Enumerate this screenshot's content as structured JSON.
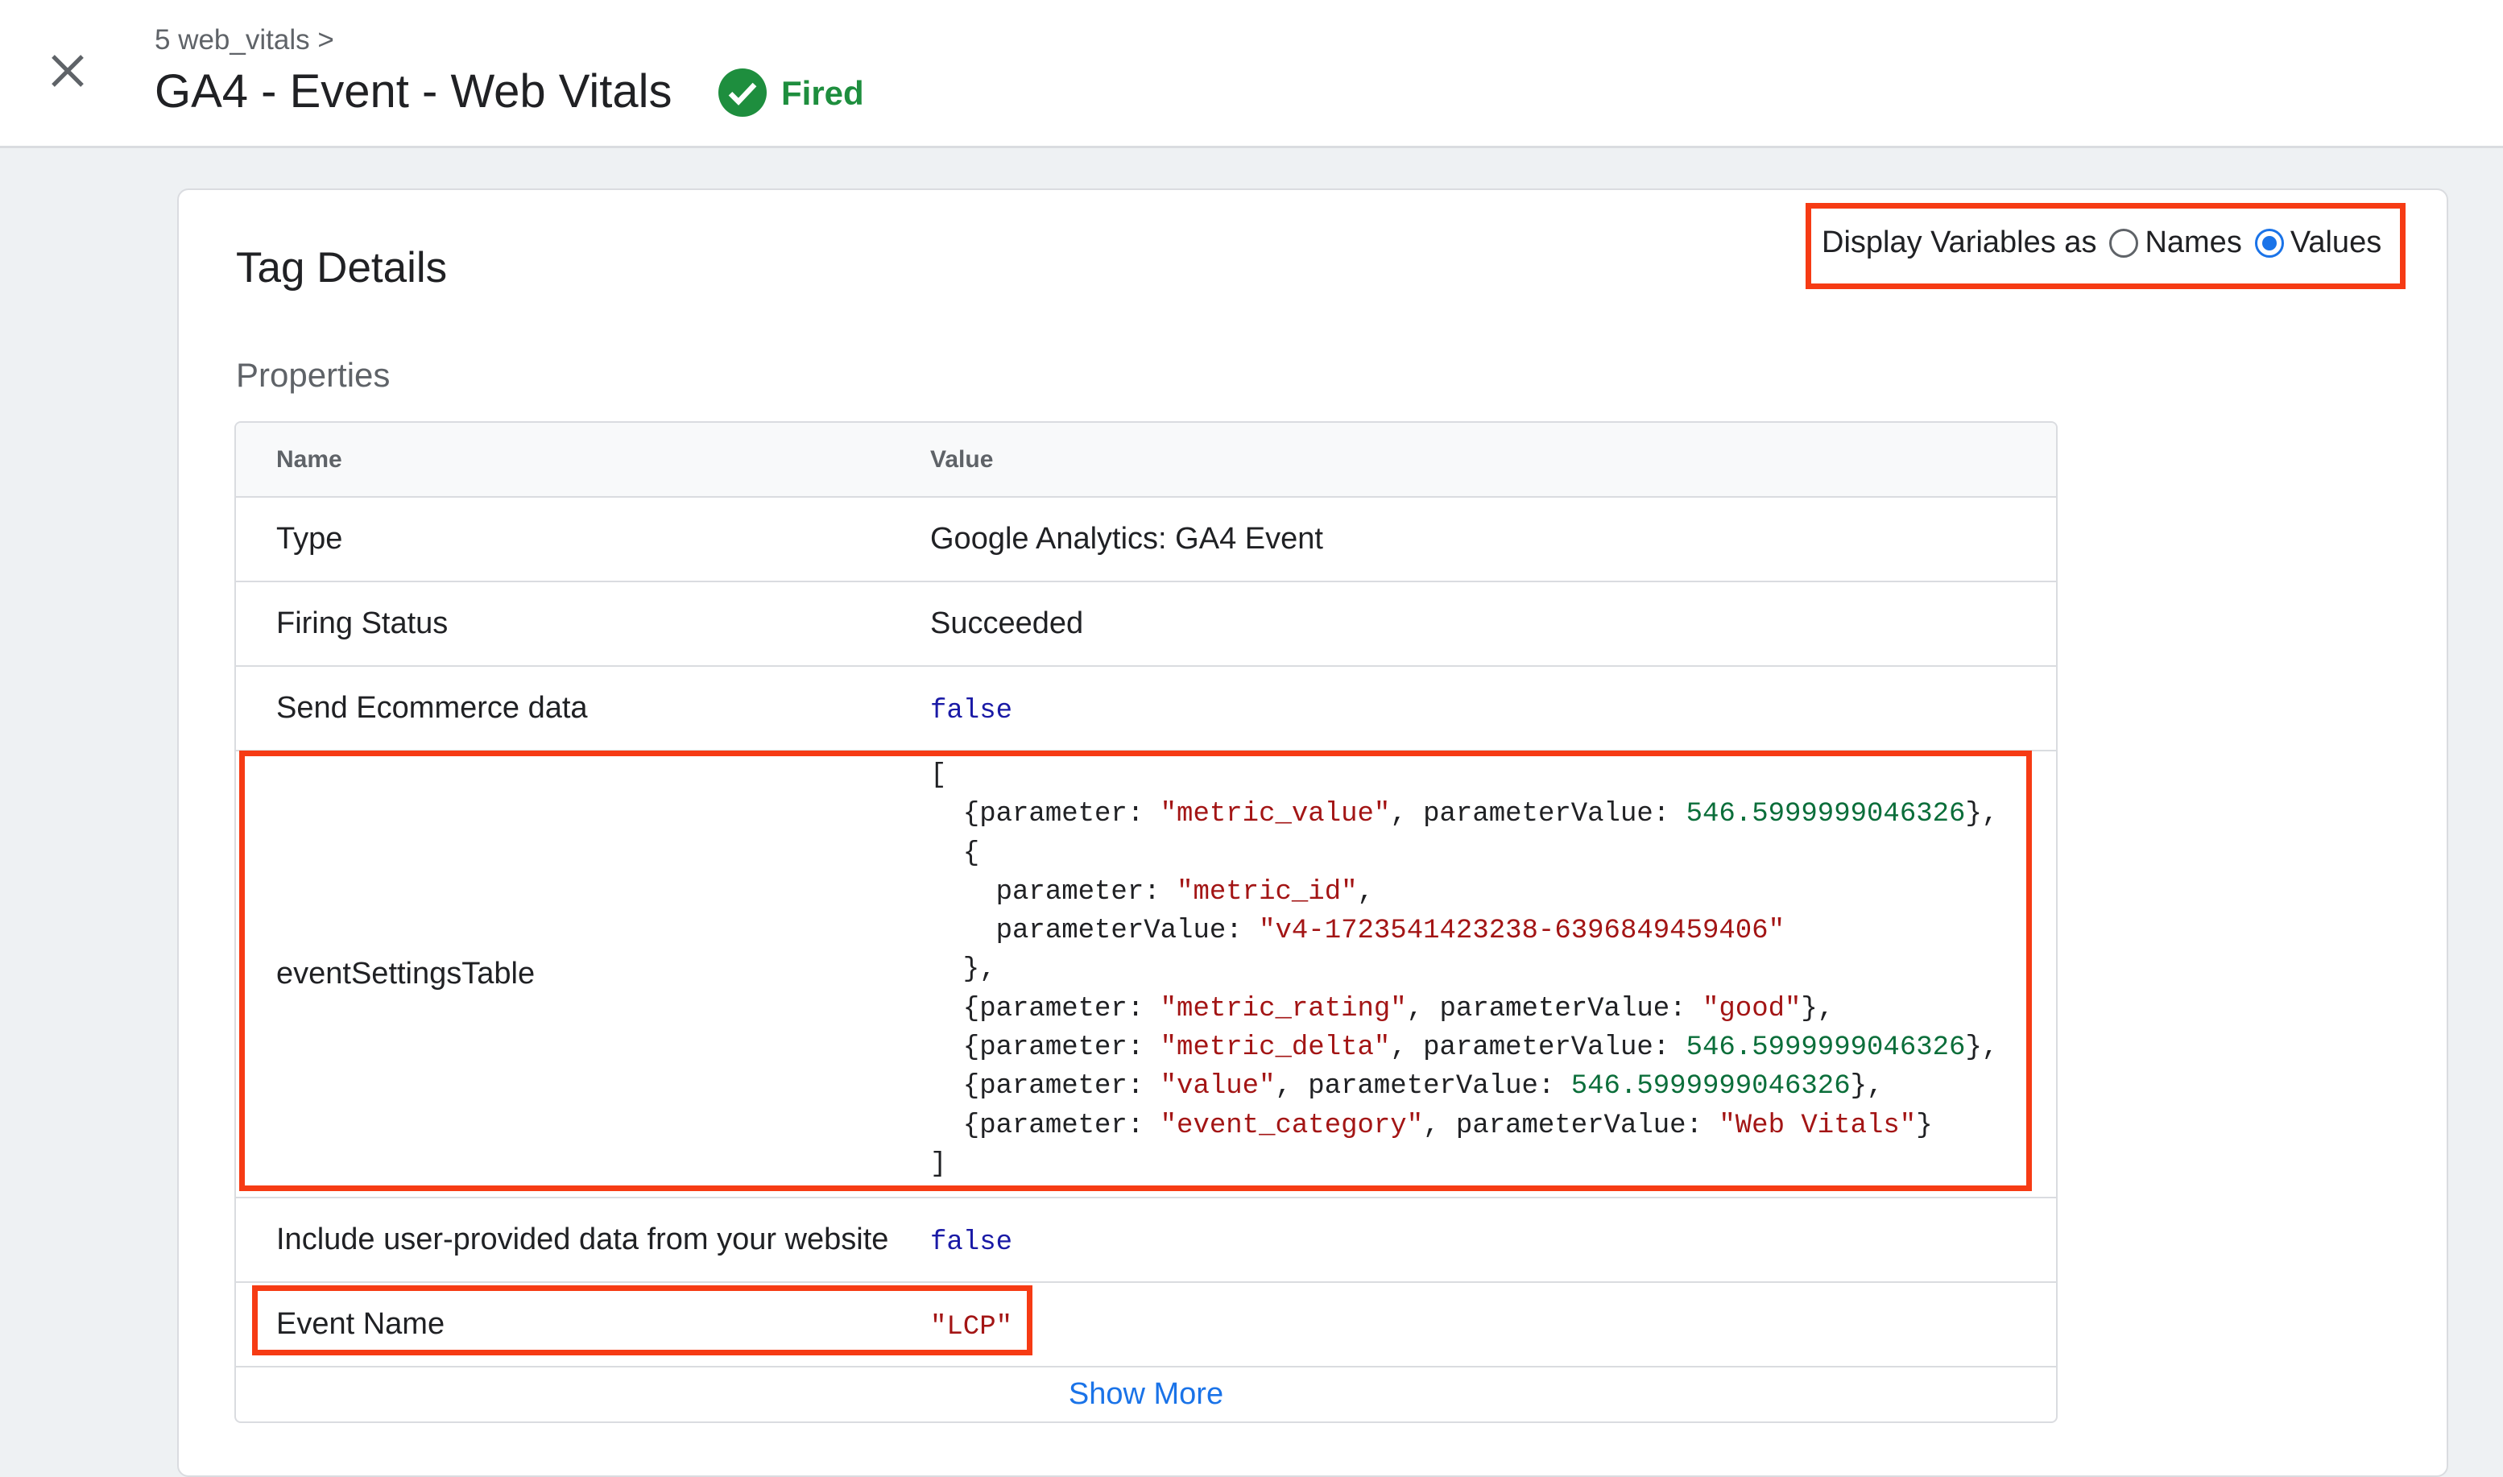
{
  "header": {
    "breadcrumb": "5 web_vitals >",
    "title": "GA4 - Event - Web Vitals",
    "status": "Fired",
    "status_color": "#1e8e3e"
  },
  "card": {
    "title": "Tag Details",
    "display_label": "Display Variables as",
    "opt_names": "Names",
    "opt_values": "Values",
    "selected": "Values",
    "section": "Properties"
  },
  "table": {
    "col_name": "Name",
    "col_value": "Value",
    "rows": [
      {
        "name": "Type",
        "value": "Google Analytics: GA4 Event"
      },
      {
        "name": "Firing Status",
        "value": "Succeeded"
      },
      {
        "name": "Send Ecommerce data",
        "value": "false"
      },
      {
        "name": "eventSettingsTable"
      },
      {
        "name": "Include user-provided data from your website",
        "value": "false"
      },
      {
        "name": "Event Name",
        "value": "\"LCP\""
      }
    ],
    "show_more": "Show More"
  },
  "code": {
    "open": "[",
    "close": "]",
    "l1": [
      "  {parameter: ",
      "\"metric_value\"",
      ", parameterValue: ",
      "546.5999999046326",
      "},"
    ],
    "l2": "  {",
    "l3": [
      "    parameter: ",
      "\"metric_id\"",
      ","
    ],
    "l4": [
      "    parameterValue: ",
      "\"v4-1723541423238-6396849459406\""
    ],
    "l5": "  },",
    "l6": [
      "  {parameter: ",
      "\"metric_rating\"",
      ", parameterValue: ",
      "\"good\"",
      "},"
    ],
    "l7": [
      "  {parameter: ",
      "\"metric_delta\"",
      ", parameterValue: ",
      "546.5999999046326",
      "},"
    ],
    "l8": [
      "  {parameter: ",
      "\"value\"",
      ", parameterValue: ",
      "546.5999999046326",
      "},"
    ],
    "l9": [
      "  {parameter: ",
      "\"event_category\"",
      ", parameterValue: ",
      "\"Web Vitals\"",
      "}"
    ]
  }
}
